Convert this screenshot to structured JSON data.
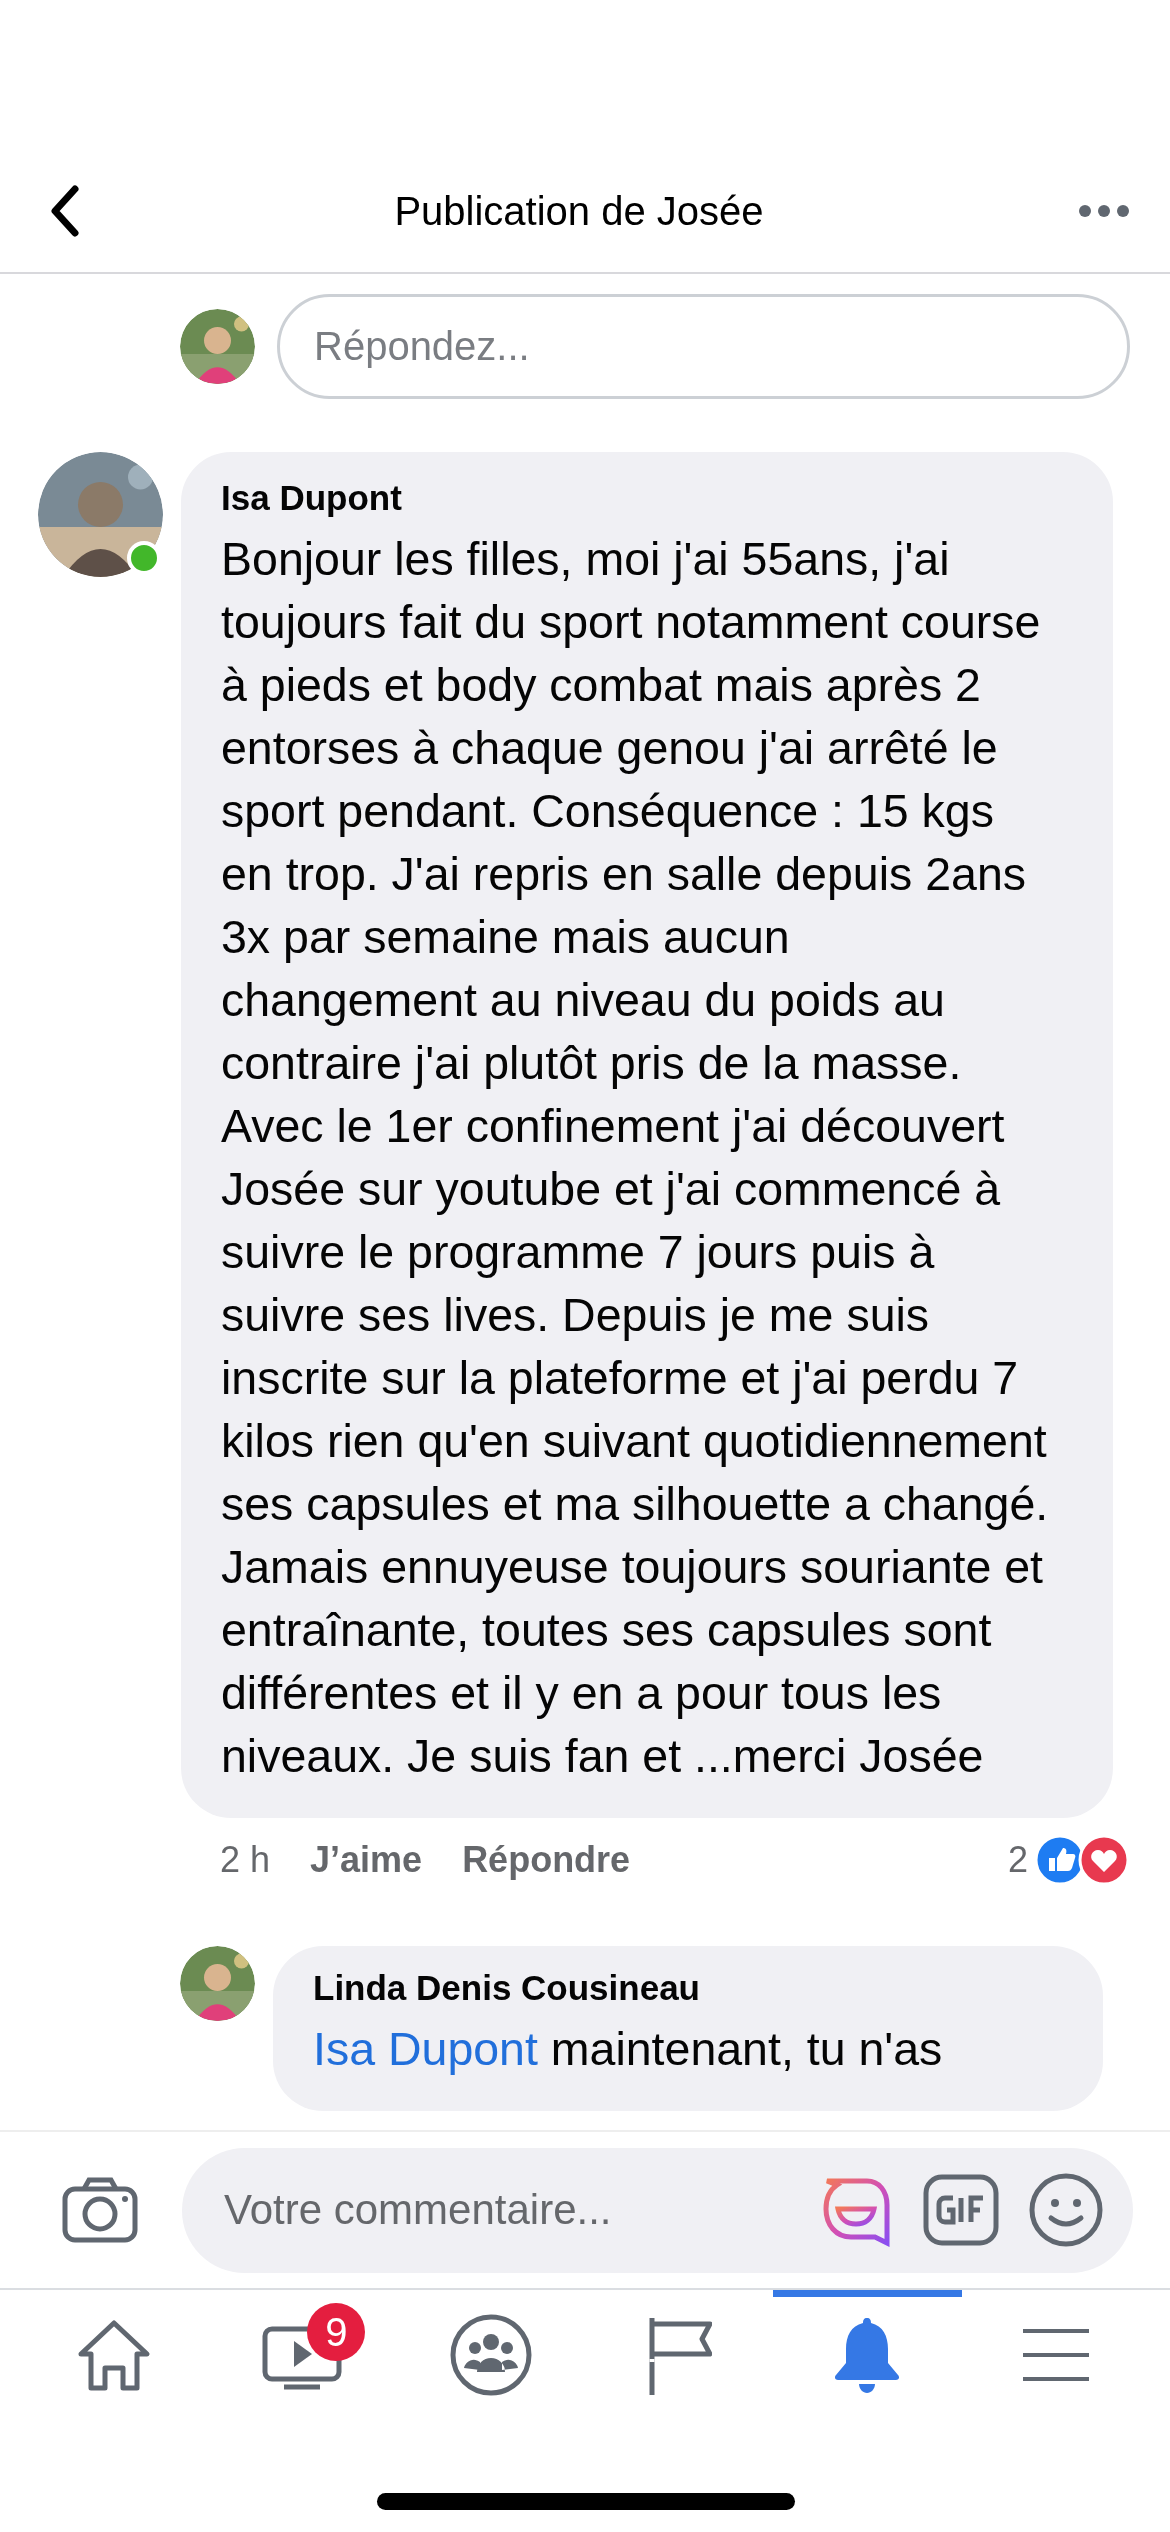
{
  "header": {
    "title": "Publication de Josée"
  },
  "reply_box": {
    "placeholder": "Répondez..."
  },
  "comments": [
    {
      "author": "Isa Dupont",
      "online": true,
      "text": "Bonjour les filles, moi j'ai 55ans, j'ai toujours fait du sport notamment course à pieds et body combat mais après 2 entorses à chaque genou j'ai arrêté le sport pendant. Conséquence : 15 kgs en trop. J'ai repris en salle depuis 2ans 3x par semaine mais aucun changement au niveau du poids au contraire j'ai plutôt pris de la masse. Avec le 1er confinement j'ai découvert Josée sur youtube et j'ai commencé à suivre le programme 7 jours puis à suivre ses lives. Depuis je me suis inscrite sur la plateforme et j'ai perdu 7 kilos rien qu'en suivant quotidiennement ses capsules et ma silhouette a changé. Jamais ennuyeuse toujours souriante et entraînante, toutes ses capsules sont différentes et il y en a pour tous les niveaux. Je suis fan et ...merci Josée",
      "time": "2 h",
      "like": "J’aime",
      "reply": "Répondre",
      "reaction_count": "2"
    },
    {
      "author": "Linda Denis Cousineau",
      "online": false,
      "mention": "Isa Dupont",
      "text": "maintenant, tu n'as"
    }
  ],
  "composer": {
    "placeholder": "Votre commentaire..."
  },
  "tabs": [
    {
      "kind": "home",
      "selected": false
    },
    {
      "kind": "watch",
      "selected": false,
      "badge": "9"
    },
    {
      "kind": "groups",
      "selected": false
    },
    {
      "kind": "pages",
      "selected": false
    },
    {
      "kind": "notifications",
      "selected": true
    },
    {
      "kind": "menu",
      "selected": false
    }
  ]
}
